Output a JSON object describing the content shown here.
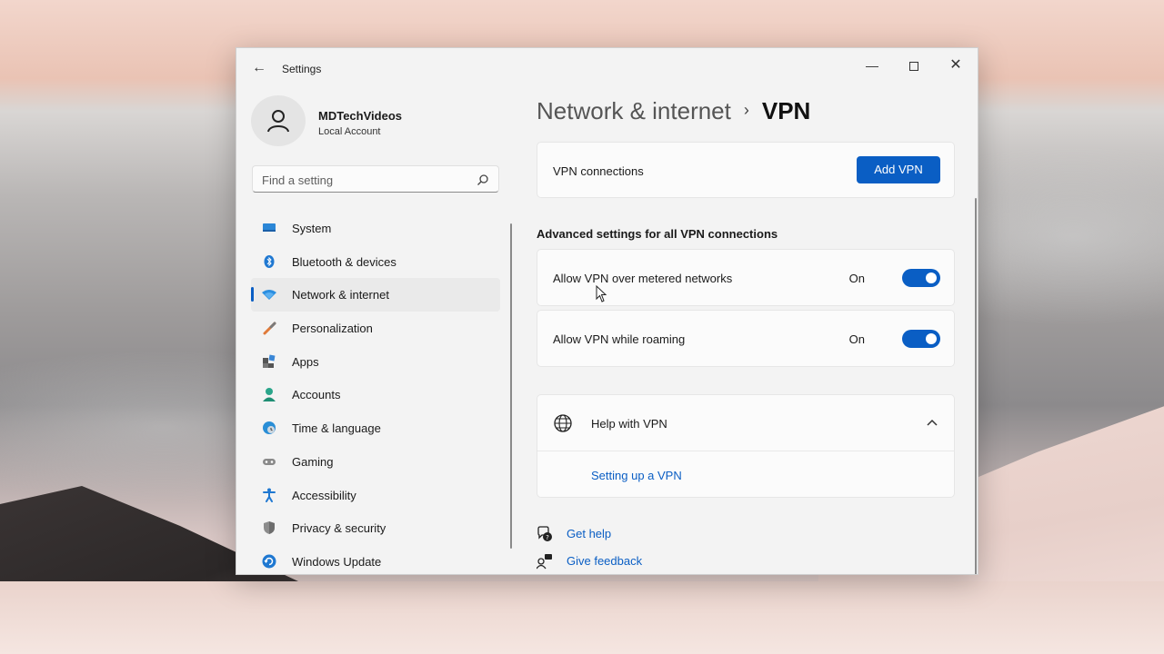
{
  "window": {
    "title": "Settings"
  },
  "profile": {
    "name": "MDTechVideos",
    "account_type": "Local Account"
  },
  "search": {
    "placeholder": "Find a setting"
  },
  "sidebar": {
    "items": [
      {
        "label": "System",
        "icon": "system-icon",
        "active": false
      },
      {
        "label": "Bluetooth & devices",
        "icon": "bluetooth-icon",
        "active": false
      },
      {
        "label": "Network & internet",
        "icon": "wifi-icon",
        "active": true
      },
      {
        "label": "Personalization",
        "icon": "brush-icon",
        "active": false
      },
      {
        "label": "Apps",
        "icon": "apps-icon",
        "active": false
      },
      {
        "label": "Accounts",
        "icon": "accounts-icon",
        "active": false
      },
      {
        "label": "Time & language",
        "icon": "globe-clock-icon",
        "active": false
      },
      {
        "label": "Gaming",
        "icon": "gamepad-icon",
        "active": false
      },
      {
        "label": "Accessibility",
        "icon": "accessibility-icon",
        "active": false
      },
      {
        "label": "Privacy & security",
        "icon": "shield-icon",
        "active": false
      },
      {
        "label": "Windows Update",
        "icon": "update-icon",
        "active": false
      }
    ]
  },
  "breadcrumb": {
    "parent": "Network & internet",
    "separator": "›",
    "current": "VPN"
  },
  "vpn": {
    "connections_label": "VPN connections",
    "add_button": "Add VPN",
    "advanced_heading": "Advanced settings for all VPN connections",
    "settings": [
      {
        "label": "Allow VPN over metered networks",
        "state": "On",
        "on": true
      },
      {
        "label": "Allow VPN while roaming",
        "state": "On",
        "on": true
      }
    ],
    "help": {
      "title": "Help with VPN",
      "link": "Setting up a VPN"
    }
  },
  "footer": {
    "get_help": "Get help",
    "give_feedback": "Give feedback"
  },
  "colors": {
    "accent": "#0a5ec4",
    "window_bg": "#f3f3f3",
    "card_bg": "#fbfbfb"
  }
}
